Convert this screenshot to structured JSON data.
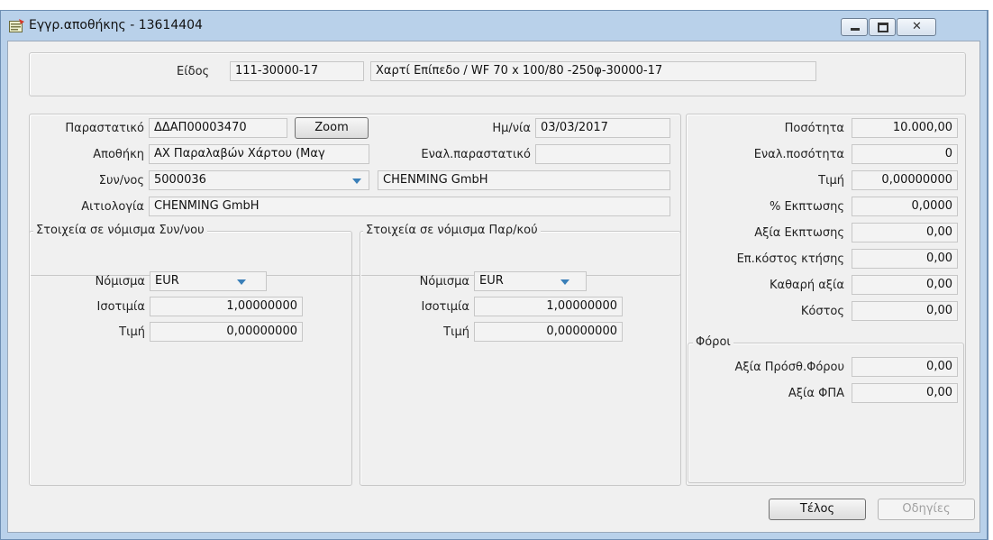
{
  "window": {
    "title": "Εγγρ.αποθήκης - 13614404"
  },
  "item": {
    "label": "Είδος",
    "code": "111-30000-17",
    "description": "Χαρτί Επίπεδο / WF 70 x 100/80 -250φ-30000-17"
  },
  "doc": {
    "doc_label": "Παραστατικό",
    "doc_value": "ΔΔΑΠ00003470",
    "zoom_label": "Zoom",
    "date_label": "Ημ/νία",
    "date_value": "03/03/2017",
    "warehouse_label": "Αποθήκη",
    "warehouse_value": "ΑΧ Παραλαβών Χάρτου (Μαγ",
    "alt_doc_label": "Εναλ.παραστατικό",
    "alt_doc_value": "",
    "partner_label": "Συν/νος",
    "partner_code": "5000036",
    "partner_name": "CHENMING GmbH",
    "reason_label": "Αιτιολογία",
    "reason_value": "CHENMING GmbH"
  },
  "partner_currency": {
    "title": "Στοιχεία σε νόμισμα Συν/νου",
    "currency_label": "Νόμισμα",
    "currency_value": "EUR",
    "rate_label": "Ισοτιμία",
    "rate_value": "1,00000000",
    "price_label": "Τιμή",
    "price_value": "0,00000000"
  },
  "doc_currency": {
    "title": "Στοιχεία σε νόμισμα Παρ/κού",
    "currency_label": "Νόμισμα",
    "currency_value": "EUR",
    "rate_label": "Ισοτιμία",
    "rate_value": "1,00000000",
    "price_label": "Τιμή",
    "price_value": "0,00000000"
  },
  "totals": {
    "quantity_label": "Ποσότητα",
    "quantity_value": "10.000,00",
    "alt_quantity_label": "Εναλ.ποσότητα",
    "alt_quantity_value": "0",
    "price_label": "Τιμή",
    "price_value": "0,00000000",
    "discount_pct_label": "% Εκπτωσης",
    "discount_pct_value": "0,0000",
    "discount_value_label": "Αξία Εκπτωσης",
    "discount_value_value": "0,00",
    "acq_cost_label": "Επ.κόστος κτήσης",
    "acq_cost_value": "0,00",
    "net_value_label": "Καθαρή αξία",
    "net_value_value": "0,00",
    "cost_label": "Κόστος",
    "cost_value": "0,00"
  },
  "taxes": {
    "title": "Φόροι",
    "extra_tax_label": "Αξία Πρόσθ.Φόρου",
    "extra_tax_value": "0,00",
    "vat_label": "Αξία ΦΠΑ",
    "vat_value": "0,00"
  },
  "buttons": {
    "end": "Τέλος",
    "instructions": "Οδηγίες"
  }
}
